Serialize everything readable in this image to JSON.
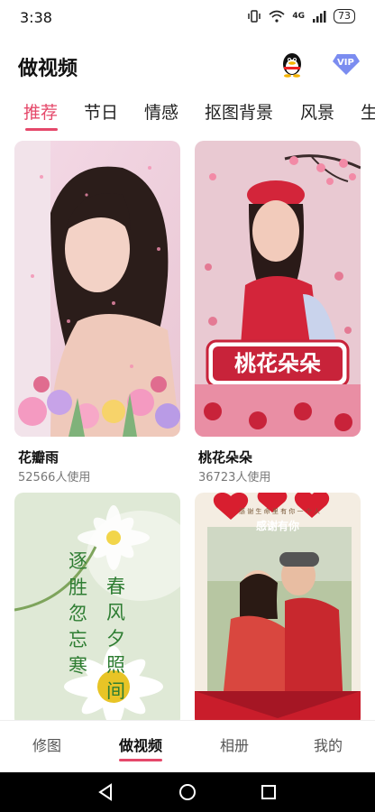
{
  "status_bar": {
    "time": "3:38",
    "battery": "73",
    "signal_label": "4G"
  },
  "header": {
    "title": "做视频",
    "vip_label": "VIP"
  },
  "tabs": [
    {
      "label": "推荐",
      "active": true
    },
    {
      "label": "节日",
      "active": false
    },
    {
      "label": "情感",
      "active": false
    },
    {
      "label": "抠图背景",
      "active": false
    },
    {
      "label": "风景",
      "active": false
    },
    {
      "label": "生",
      "active": false
    }
  ],
  "cards": [
    {
      "title": "花瓣雨",
      "usage": "52566人使用"
    },
    {
      "title": "桃花朵朵",
      "usage": "36723人使用",
      "overlay_text": "桃花朵朵"
    },
    {
      "title": "",
      "usage": "",
      "poem": [
        "逐",
        "胜",
        "忽",
        "忘",
        "寒",
        "春",
        "风",
        "夕",
        "照",
        "间"
      ]
    },
    {
      "title": "",
      "usage": "",
      "banner": "感谢有你",
      "top_text": "感 谢 生 命 里 有 你 一 个 人"
    }
  ],
  "bottom_nav": [
    {
      "label": "修图",
      "active": false
    },
    {
      "label": "做视频",
      "active": true
    },
    {
      "label": "相册",
      "active": false
    },
    {
      "label": "我的",
      "active": false
    }
  ],
  "colors": {
    "accent": "#e5486a",
    "text": "#111111",
    "subtext": "#777777"
  }
}
